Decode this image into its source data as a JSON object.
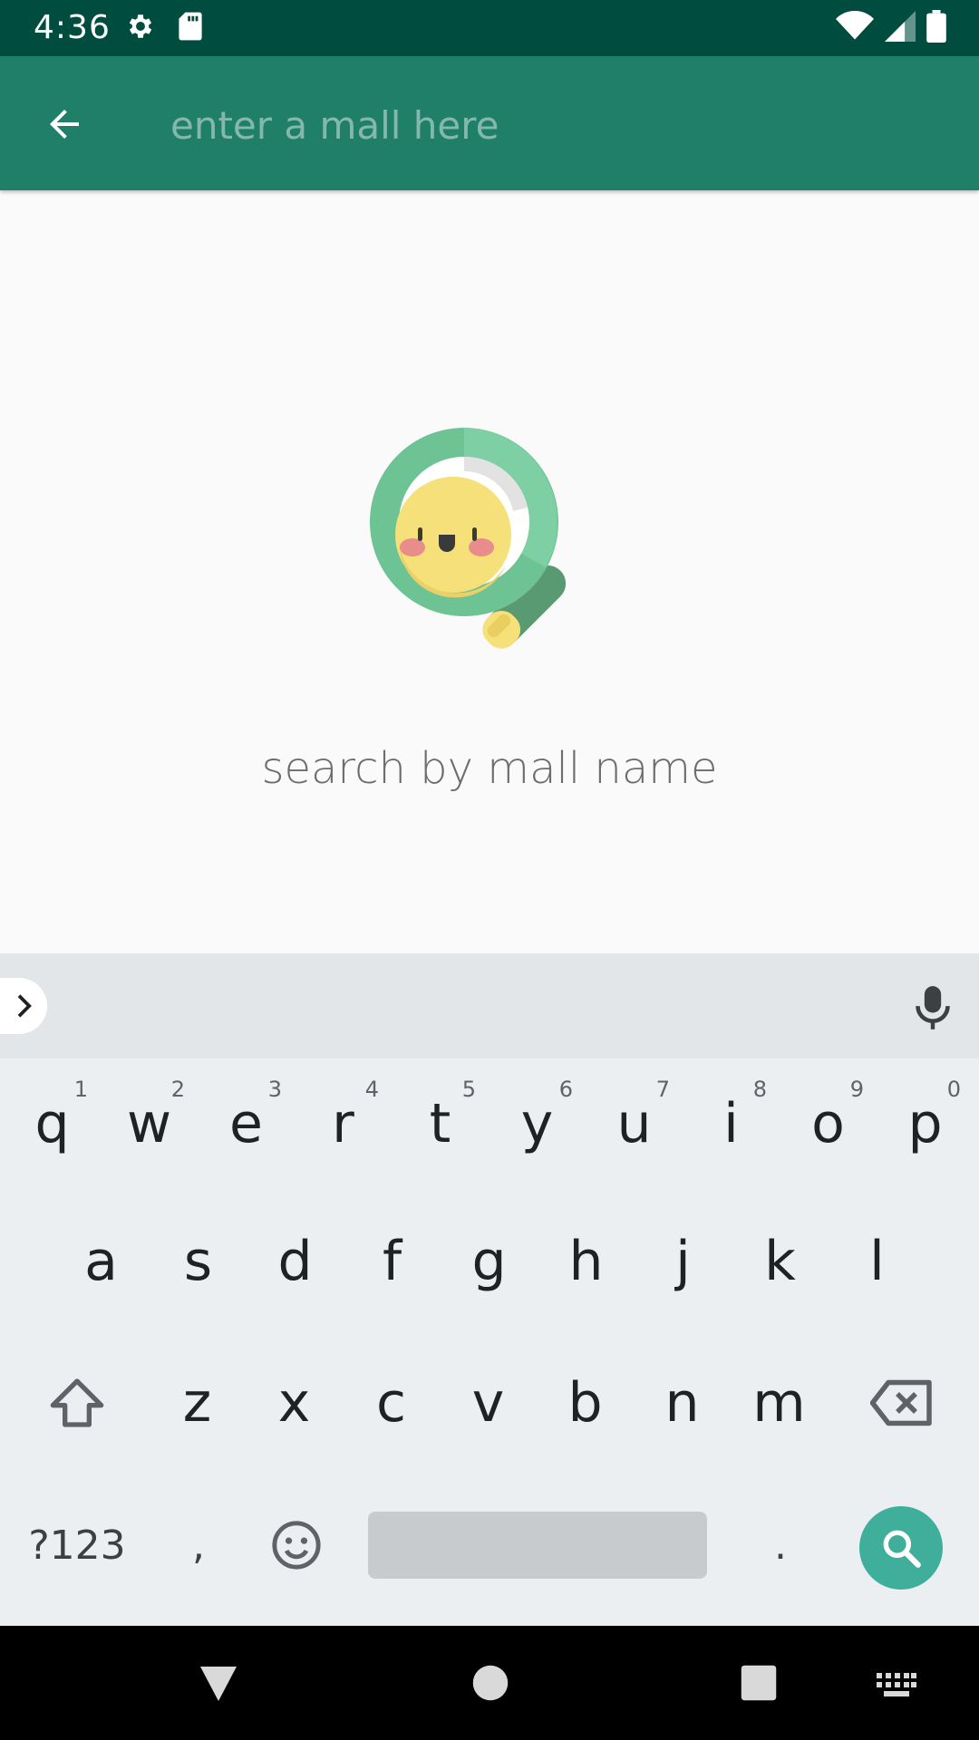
{
  "status_bar": {
    "time": "4:36",
    "icons_left": [
      "settings-icon",
      "sd-card-icon"
    ],
    "icons_right": [
      "wifi-icon",
      "signal-icon",
      "battery-icon"
    ]
  },
  "app_bar": {
    "back_icon": "arrow-back-icon",
    "search_placeholder": "enter a mall here",
    "search_value": "",
    "background": "#1f7f69"
  },
  "empty_state": {
    "illustration": "magnifier-with-smiley-icon",
    "text": "search by mall name"
  },
  "keyboard": {
    "row1": [
      {
        "label": "q",
        "hint": "1"
      },
      {
        "label": "w",
        "hint": "2"
      },
      {
        "label": "e",
        "hint": "3"
      },
      {
        "label": "r",
        "hint": "4"
      },
      {
        "label": "t",
        "hint": "5"
      },
      {
        "label": "y",
        "hint": "6"
      },
      {
        "label": "u",
        "hint": "7"
      },
      {
        "label": "i",
        "hint": "8"
      },
      {
        "label": "o",
        "hint": "9"
      },
      {
        "label": "p",
        "hint": "0"
      }
    ],
    "row2": [
      "a",
      "s",
      "d",
      "f",
      "g",
      "h",
      "j",
      "k",
      "l"
    ],
    "row3": [
      "z",
      "x",
      "c",
      "v",
      "b",
      "n",
      "m"
    ],
    "symbols_label": "?123",
    "comma_label": ",",
    "period_label": ".",
    "action_color": "#3fae9b"
  },
  "nav_bar": {
    "buttons": [
      "back-triangle-icon",
      "home-circle-icon",
      "recents-square-icon",
      "keyboard-switch-icon"
    ]
  }
}
